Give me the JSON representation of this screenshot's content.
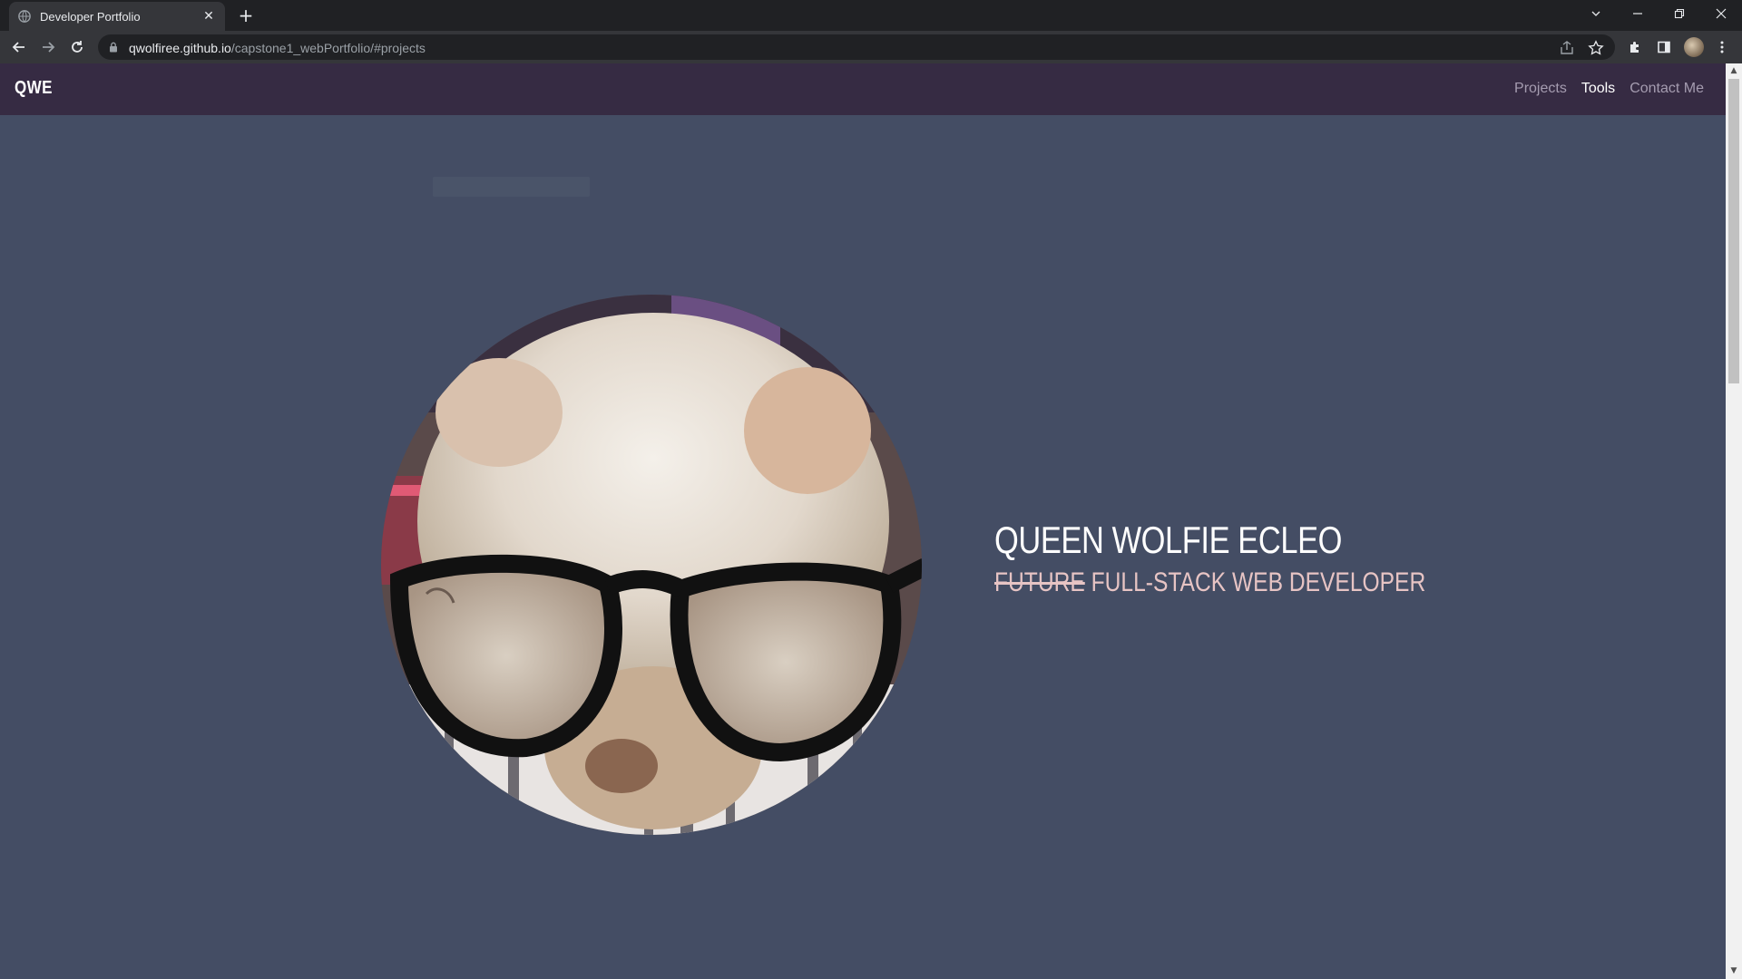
{
  "browser": {
    "tab": {
      "title": "Developer Portfolio",
      "close": "✕"
    },
    "new_tab": "+",
    "url": {
      "host": "qwolfiree.github.io",
      "path": "/capstone1_webPortfolio/#projects"
    }
  },
  "site": {
    "brand": "QWE",
    "nav": [
      {
        "label": "Projects",
        "active": false
      },
      {
        "label": "Tools",
        "active": true
      },
      {
        "label": "Contact Me",
        "active": false
      }
    ],
    "hero": {
      "name": "QUEEN WOLFIE ECLEO",
      "role_struck": "FUTURE",
      "role_rest": " FULL-STACK WEB DEVELOPER",
      "photo_alt": "white fluffy dog wearing black glasses"
    }
  },
  "colors": {
    "page_bg": "#444d64",
    "navbar_bg": "#362b43",
    "role_text": "#e7c4c4"
  },
  "icons": [
    "favicon-icon",
    "close-icon",
    "plus-icon",
    "chevron-down-icon",
    "minimize-icon",
    "restore-icon",
    "window-close-icon",
    "back-icon",
    "forward-icon",
    "reload-icon",
    "lock-icon",
    "share-icon",
    "star-icon",
    "extensions-icon",
    "side-panel-icon",
    "menu-icon"
  ]
}
